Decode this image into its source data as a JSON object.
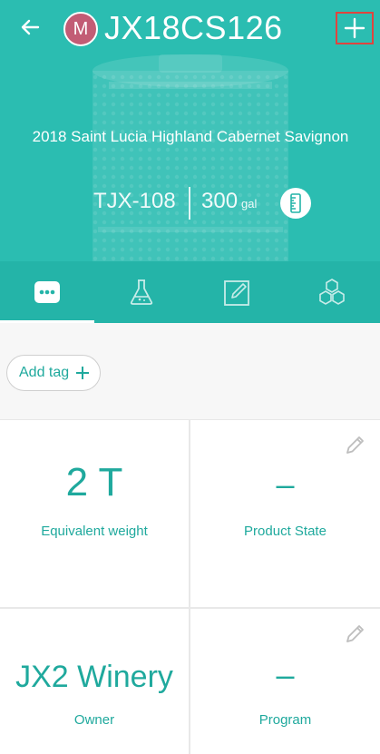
{
  "header": {
    "avatar_initial": "M",
    "vessel_id": "JX18CS126",
    "wine_name": "2018 Saint Lucia Highland Cabernet Savignon",
    "vessel_code": "TJX-108",
    "volume": "300",
    "volume_unit": "gal"
  },
  "tabs": [
    {
      "name": "overview",
      "icon": "more-dots-icon",
      "active": true
    },
    {
      "name": "lab",
      "icon": "flask-icon",
      "active": false
    },
    {
      "name": "notes",
      "icon": "edit-note-icon",
      "active": false
    },
    {
      "name": "composition",
      "icon": "hexagons-icon",
      "active": false
    }
  ],
  "tags": {
    "add_label": "Add tag"
  },
  "cards": {
    "weight": {
      "value": "2 T",
      "label": "Equivalent weight"
    },
    "product_state": {
      "value": "–",
      "label": "Product State"
    },
    "owner": {
      "value": "JX2 Winery",
      "label": "Owner"
    },
    "program": {
      "value": "–",
      "label": "Program"
    }
  },
  "colors": {
    "primary": "#2bbdb1",
    "tab_bar": "#24b4a8",
    "accent_text": "#1fa99d",
    "avatar": "#c25c75",
    "highlight_border": "#e0443e"
  }
}
